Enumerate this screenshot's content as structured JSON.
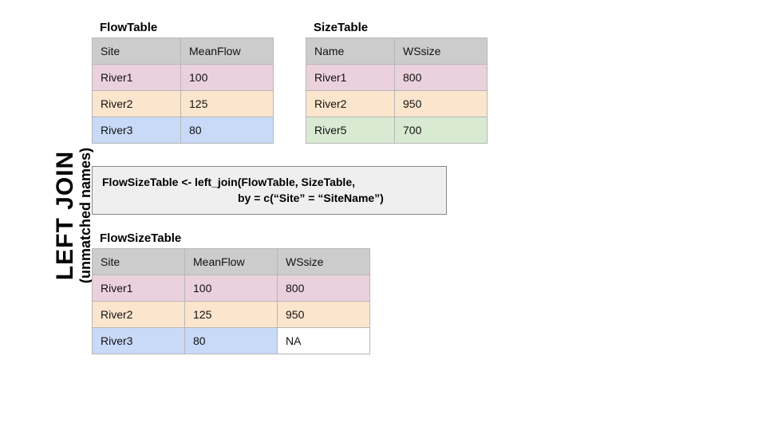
{
  "sideLabel": {
    "title": "LEFT JOIN",
    "subtitle": "(unmatched names)"
  },
  "flowTable": {
    "title": "FlowTable",
    "headers": [
      "Site",
      "MeanFlow"
    ],
    "rows": [
      {
        "cells": [
          "River1",
          "100"
        ],
        "cls": "pink"
      },
      {
        "cells": [
          "River2",
          "125"
        ],
        "cls": "peach"
      },
      {
        "cells": [
          "River3",
          "80"
        ],
        "cls": "blue"
      }
    ]
  },
  "sizeTable": {
    "title": "SizeTable",
    "headers": [
      "Name",
      "WSsize"
    ],
    "rows": [
      {
        "cells": [
          "River1",
          "800"
        ],
        "cls": "pink"
      },
      {
        "cells": [
          "River2",
          "950"
        ],
        "cls": "peach"
      },
      {
        "cells": [
          "River5",
          "700"
        ],
        "cls": "green"
      }
    ]
  },
  "code": {
    "line1": "FlowSizeTable <- left_join(FlowTable, SizeTable,",
    "line2": "by = c(“Site”  = “SiteName”)"
  },
  "resultTable": {
    "title": "FlowSizeTable",
    "headers": [
      "Site",
      "MeanFlow",
      "WSsize"
    ],
    "rows": [
      {
        "cells": [
          "River1",
          "100",
          "800"
        ],
        "cls": [
          "pink",
          "pink",
          "pink"
        ]
      },
      {
        "cells": [
          "River2",
          "125",
          "950"
        ],
        "cls": [
          "peach",
          "peach",
          "peach"
        ]
      },
      {
        "cells": [
          "River3",
          "80",
          "NA"
        ],
        "cls": [
          "blue",
          "blue",
          "white"
        ]
      }
    ]
  },
  "chart_data": {
    "type": "table",
    "operation": "left_join",
    "left": {
      "name": "FlowTable",
      "key": "Site",
      "columns": [
        "Site",
        "MeanFlow"
      ],
      "rows": [
        [
          "River1",
          100
        ],
        [
          "River2",
          125
        ],
        [
          "River3",
          80
        ]
      ]
    },
    "right": {
      "name": "SizeTable",
      "key": "Name",
      "columns": [
        "Name",
        "WSsize"
      ],
      "rows": [
        [
          "River1",
          800
        ],
        [
          "River2",
          950
        ],
        [
          "River5",
          700
        ]
      ]
    },
    "by": {
      "Site": "SiteName"
    },
    "result": {
      "name": "FlowSizeTable",
      "columns": [
        "Site",
        "MeanFlow",
        "WSsize"
      ],
      "rows": [
        [
          "River1",
          100,
          800
        ],
        [
          "River2",
          125,
          950
        ],
        [
          "River3",
          80,
          null
        ]
      ]
    }
  }
}
